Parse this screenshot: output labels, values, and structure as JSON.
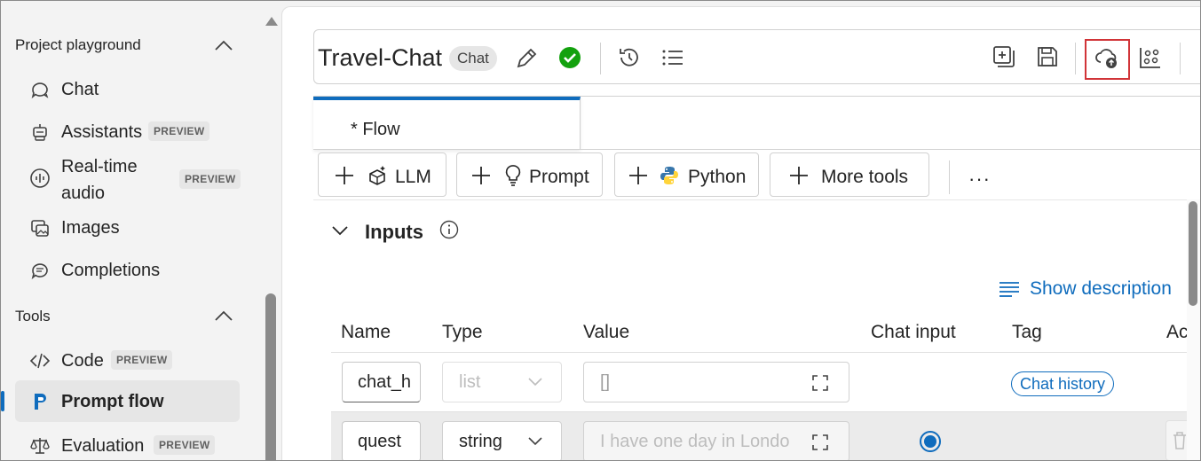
{
  "sidebar": {
    "section_playground": "Project playground",
    "section_tools": "Tools",
    "items": [
      {
        "label": "Chat"
      },
      {
        "label": "Assistants",
        "badge": "PREVIEW"
      },
      {
        "label_line1": "Real-time",
        "label_line2": "audio",
        "badge": "PREVIEW"
      },
      {
        "label": "Images"
      },
      {
        "label": "Completions"
      }
    ],
    "tools": [
      {
        "label": "Code",
        "badge": "PREVIEW"
      },
      {
        "label": "Prompt flow",
        "active": true
      },
      {
        "label": "Evaluation",
        "badge": "PREVIEW"
      }
    ]
  },
  "header": {
    "flow_name": "Travel-Chat",
    "flow_type_badge": "Chat",
    "status": "valid",
    "icons": [
      "edit-icon",
      "check-circle-icon",
      "history-icon",
      "list-icon",
      "add-page-icon",
      "save-icon",
      "cloud-upload-icon",
      "graph-icon"
    ]
  },
  "tabs": [
    {
      "label": "* Flow"
    }
  ],
  "toolbar": {
    "llm_label": "LLM",
    "prompt_label": "Prompt",
    "python_label": "Python",
    "more_tools_label": "More tools",
    "more_label": "···"
  },
  "inputs": {
    "heading": "Inputs",
    "show_description": "Show description",
    "columns": [
      "Name",
      "Type",
      "Value",
      "Chat input",
      "Tag",
      "Ac"
    ],
    "rows": [
      {
        "name": "chat_h",
        "type": "list",
        "value": "[]",
        "tag": "Chat history"
      },
      {
        "name": "quest",
        "type": "string",
        "value": "I have one day in Londo",
        "chat_input": true
      }
    ]
  },
  "colors": {
    "accent": "#0f6cbd",
    "success": "#13a10e",
    "highlight": "#d13438"
  }
}
